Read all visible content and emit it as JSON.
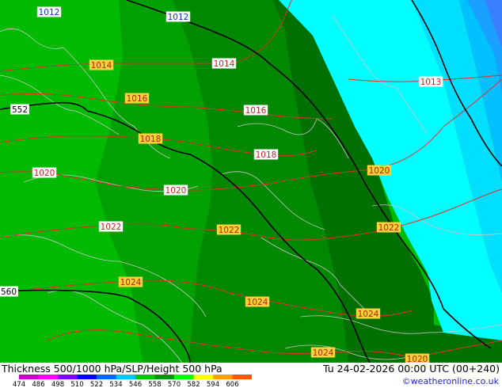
{
  "map": {
    "pressure_labels": [
      {
        "text": "1012",
        "style": "blue"
      },
      {
        "text": "1012",
        "style": "blue"
      },
      {
        "text": "1013",
        "style": "red"
      },
      {
        "text": "1014",
        "style": "orange"
      },
      {
        "text": "1014",
        "style": "red"
      },
      {
        "text": "1016",
        "style": "orange"
      },
      {
        "text": "1016",
        "style": "red"
      },
      {
        "text": "1018",
        "style": "orange"
      },
      {
        "text": "1018",
        "style": "red"
      },
      {
        "text": "1020",
        "style": "red"
      },
      {
        "text": "1020",
        "style": "red"
      },
      {
        "text": "1020",
        "style": "orange"
      },
      {
        "text": "1022",
        "style": "red"
      },
      {
        "text": "1022",
        "style": "orange"
      },
      {
        "text": "1022",
        "style": "orange"
      },
      {
        "text": "1024",
        "style": "orange"
      },
      {
        "text": "1024",
        "style": "orange"
      },
      {
        "text": "1024",
        "style": "orange"
      },
      {
        "text": "1024",
        "style": "orange"
      },
      {
        "text": "1020",
        "style": "orange"
      }
    ],
    "height_labels": [
      "552",
      "560"
    ],
    "colors": {
      "thickness_bands": [
        "#00ba00",
        "#00a000",
        "#008800",
        "#007000",
        "#00ffff",
        "#00dfff",
        "#00c0ff",
        "#1aa0ff",
        "#3a7fff"
      ],
      "isobar": "#e03030",
      "height_contour": "#000000",
      "coastline": "#c8c8c8"
    }
  },
  "footer": {
    "title": "Thickness 500/1000 hPa/SLP/Height 500 hPa",
    "datetime": "Tu 24-02-2026 00:00 UTC (00+240)",
    "credit": "©weatheronline.co.uk",
    "scale_values": [
      "474",
      "486",
      "498",
      "510",
      "522",
      "534",
      "546",
      "558",
      "570",
      "582",
      "594",
      "606"
    ],
    "scale_colors": [
      "#c800c8",
      "#ff00ff",
      "#8000ff",
      "#0000ff",
      "#0064ff",
      "#00c8ff",
      "#00c800",
      "#009600",
      "#00ff00",
      "#ffff00",
      "#ffa000",
      "#ff5a00"
    ]
  }
}
